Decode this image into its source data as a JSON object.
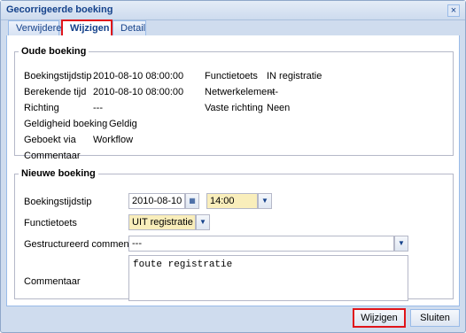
{
  "window": {
    "title": "Gecorrigeerde boeking"
  },
  "tabs": [
    {
      "label": "Verwijderen"
    },
    {
      "label": "Wijzigen"
    },
    {
      "label": "Detail"
    }
  ],
  "oude_boeking": {
    "legend": "Oude boeking",
    "left": [
      {
        "label": "Boekingstijdstip",
        "value": "2010-08-10 08:00:00"
      },
      {
        "label": "Berekende tijd",
        "value": "2010-08-10 08:00:00"
      },
      {
        "label": "Richting",
        "value": "---"
      },
      {
        "label": "Geldigheid boeking",
        "value": "Geldig"
      },
      {
        "label": "Geboekt via",
        "value": "Workflow"
      },
      {
        "label": "Commentaar",
        "value": ""
      }
    ],
    "right": [
      {
        "label": "Functietoets",
        "value": "IN registratie"
      },
      {
        "label": "Netwerkelement",
        "value": "---"
      },
      {
        "label": "Vaste richting",
        "value": "Neen"
      }
    ]
  },
  "nieuwe_boeking": {
    "legend": "Nieuwe boeking",
    "boekingstijdstip_label": "Boekingstijdstip",
    "date_value": "2010-08-10",
    "time_value": "14:00",
    "functietoets_label": "Functietoets",
    "functietoets_value": "UIT registratie",
    "gestructureerd_label": "Gestructureerd commentaar",
    "gestructureerd_value": "---",
    "commentaar_label": "Commentaar",
    "commentaar_value": "foute registratie"
  },
  "footer": {
    "wijzigen_label": "Wijzigen",
    "sluiten_label": "Sluiten"
  },
  "colors": {
    "highlight": "#e0151a",
    "field_yellow": "#f9eebb",
    "title_blue": "#15428b"
  }
}
